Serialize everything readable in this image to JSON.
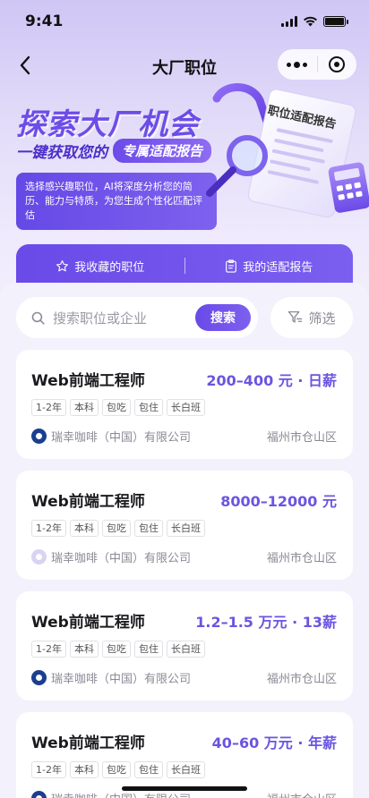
{
  "status_bar": {
    "time": "9:41"
  },
  "nav": {
    "title": "大厂职位"
  },
  "hero": {
    "title": "探索大厂机会",
    "subtitle": "一键获取您的",
    "badge": "专属适配报告",
    "description": "选择感兴趣职位，AI将深度分析您的简历、能力与特质，为您生成个性化匹配评估",
    "illustration_label": "职位适配报告"
  },
  "quick_bar": {
    "favorites_label": "我收藏的职位",
    "reports_label": "我的适配报告"
  },
  "search": {
    "placeholder": "搜索职位或企业",
    "button_label": "搜索",
    "filter_label": "筛选"
  },
  "jobs": [
    {
      "title": "Web前端工程师",
      "salary": "200–400 元 · 日薪",
      "tags": [
        "1-2年",
        "本科",
        "包吃",
        "包住",
        "长白班"
      ],
      "company": "瑞幸咖啡（中国）有限公司",
      "location": "福州市仓山区",
      "logo": "luckin-logo"
    },
    {
      "title": "Web前端工程师",
      "salary": "8000–12000 元",
      "tags": [
        "1-2年",
        "本科",
        "包吃",
        "包住",
        "长白班"
      ],
      "company": "瑞幸咖啡（中国）有限公司",
      "location": "福州市仓山区",
      "logo": "placeholder-logo"
    },
    {
      "title": "Web前端工程师",
      "salary": "1.2–1.5 万元 · 13薪",
      "tags": [
        "1-2年",
        "本科",
        "包吃",
        "包住",
        "长白班"
      ],
      "company": "瑞幸咖啡（中国）有限公司",
      "location": "福州市仓山区",
      "logo": "luckin-logo"
    },
    {
      "title": "Web前端工程师",
      "salary": "40–60 万元 · 年薪",
      "tags": [
        "1-2年",
        "本科",
        "包吃",
        "包住",
        "长白班"
      ],
      "company": "瑞幸咖啡（中国）有限公司",
      "location": "福州市仓山区",
      "logo": "luckin-logo"
    }
  ],
  "colors": {
    "accent": "#6a4ae8",
    "salary": "#6a55e0",
    "background": "#f3f1fb"
  }
}
